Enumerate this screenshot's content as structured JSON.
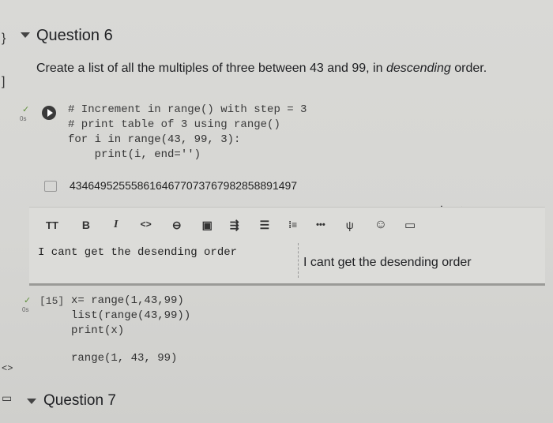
{
  "left_rail": {
    "top_glyph": "}",
    "mid_glyph": "]",
    "code_glyph": "<>",
    "terminal_glyph": "▭"
  },
  "section_q6": {
    "title": "Question 6"
  },
  "prompt": {
    "text_before": "Create a list of all the multiples of three between 43 and 99, in ",
    "text_em": "descending",
    "text_after": " order."
  },
  "cell1": {
    "status": "✓",
    "exec_time": "0s",
    "lines": [
      "# Increment in range() with step = 3",
      "# print table of 3 using range()",
      "for i in range(43, 99, 3):",
      "    print(i, end='')"
    ],
    "output_icon": "output-icon",
    "output": "4346495255586164677073767982858891497"
  },
  "editor_toolbar": {
    "items": [
      "TT",
      "B",
      "I",
      "<>",
      "⊖",
      "▣",
      "⇶",
      "☰",
      "⁞≡",
      "•••",
      "ψ",
      "☺",
      "▭"
    ]
  },
  "cell_toolbar": {
    "items": [
      "↑",
      "↓",
      "⊖",
      "▤",
      "✲",
      "✕",
      "⧉"
    ]
  },
  "text_cell": {
    "source": "I cant get the desending order",
    "preview": "I cant get the desending order"
  },
  "cell2": {
    "status": "✓",
    "exec_time": "0s",
    "exec_count": "[15]",
    "lines": [
      "x= range(1,43,99)",
      "list(range(43,99))",
      "print(x)"
    ],
    "output": "range(1, 43, 99)"
  },
  "section_q7": {
    "title": "Question 7"
  },
  "colors": {
    "background": "#d8d8d5",
    "check": "#5f8f3a"
  }
}
